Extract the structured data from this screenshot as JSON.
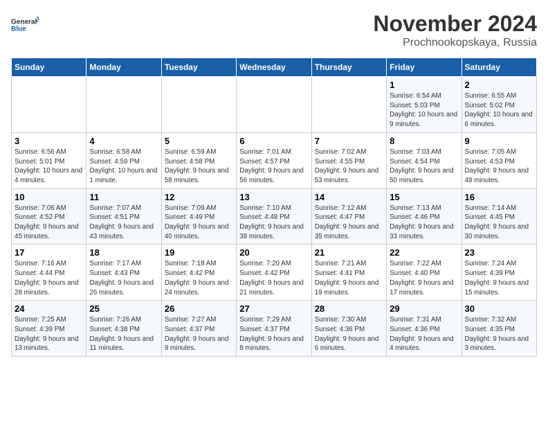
{
  "header": {
    "logo_line1": "General",
    "logo_line2": "Blue",
    "title": "November 2024",
    "location": "Prochnookopskaya, Russia"
  },
  "weekdays": [
    "Sunday",
    "Monday",
    "Tuesday",
    "Wednesday",
    "Thursday",
    "Friday",
    "Saturday"
  ],
  "weeks": [
    [
      {
        "day": "",
        "info": ""
      },
      {
        "day": "",
        "info": ""
      },
      {
        "day": "",
        "info": ""
      },
      {
        "day": "",
        "info": ""
      },
      {
        "day": "",
        "info": ""
      },
      {
        "day": "1",
        "info": "Sunrise: 6:54 AM\nSunset: 5:03 PM\nDaylight: 10 hours and 9 minutes."
      },
      {
        "day": "2",
        "info": "Sunrise: 6:55 AM\nSunset: 5:02 PM\nDaylight: 10 hours and 6 minutes."
      }
    ],
    [
      {
        "day": "3",
        "info": "Sunrise: 6:56 AM\nSunset: 5:01 PM\nDaylight: 10 hours and 4 minutes."
      },
      {
        "day": "4",
        "info": "Sunrise: 6:58 AM\nSunset: 4:59 PM\nDaylight: 10 hours and 1 minute."
      },
      {
        "day": "5",
        "info": "Sunrise: 6:59 AM\nSunset: 4:58 PM\nDaylight: 9 hours and 58 minutes."
      },
      {
        "day": "6",
        "info": "Sunrise: 7:01 AM\nSunset: 4:57 PM\nDaylight: 9 hours and 56 minutes."
      },
      {
        "day": "7",
        "info": "Sunrise: 7:02 AM\nSunset: 4:55 PM\nDaylight: 9 hours and 53 minutes."
      },
      {
        "day": "8",
        "info": "Sunrise: 7:03 AM\nSunset: 4:54 PM\nDaylight: 9 hours and 50 minutes."
      },
      {
        "day": "9",
        "info": "Sunrise: 7:05 AM\nSunset: 4:53 PM\nDaylight: 9 hours and 48 minutes."
      }
    ],
    [
      {
        "day": "10",
        "info": "Sunrise: 7:06 AM\nSunset: 4:52 PM\nDaylight: 9 hours and 45 minutes."
      },
      {
        "day": "11",
        "info": "Sunrise: 7:07 AM\nSunset: 4:51 PM\nDaylight: 9 hours and 43 minutes."
      },
      {
        "day": "12",
        "info": "Sunrise: 7:09 AM\nSunset: 4:49 PM\nDaylight: 9 hours and 40 minutes."
      },
      {
        "day": "13",
        "info": "Sunrise: 7:10 AM\nSunset: 4:48 PM\nDaylight: 9 hours and 38 minutes."
      },
      {
        "day": "14",
        "info": "Sunrise: 7:12 AM\nSunset: 4:47 PM\nDaylight: 9 hours and 35 minutes."
      },
      {
        "day": "15",
        "info": "Sunrise: 7:13 AM\nSunset: 4:46 PM\nDaylight: 9 hours and 33 minutes."
      },
      {
        "day": "16",
        "info": "Sunrise: 7:14 AM\nSunset: 4:45 PM\nDaylight: 9 hours and 30 minutes."
      }
    ],
    [
      {
        "day": "17",
        "info": "Sunrise: 7:16 AM\nSunset: 4:44 PM\nDaylight: 9 hours and 28 minutes."
      },
      {
        "day": "18",
        "info": "Sunrise: 7:17 AM\nSunset: 4:43 PM\nDaylight: 9 hours and 26 minutes."
      },
      {
        "day": "19",
        "info": "Sunrise: 7:18 AM\nSunset: 4:42 PM\nDaylight: 9 hours and 24 minutes."
      },
      {
        "day": "20",
        "info": "Sunrise: 7:20 AM\nSunset: 4:42 PM\nDaylight: 9 hours and 21 minutes."
      },
      {
        "day": "21",
        "info": "Sunrise: 7:21 AM\nSunset: 4:41 PM\nDaylight: 9 hours and 19 minutes."
      },
      {
        "day": "22",
        "info": "Sunrise: 7:22 AM\nSunset: 4:40 PM\nDaylight: 9 hours and 17 minutes."
      },
      {
        "day": "23",
        "info": "Sunrise: 7:24 AM\nSunset: 4:39 PM\nDaylight: 9 hours and 15 minutes."
      }
    ],
    [
      {
        "day": "24",
        "info": "Sunrise: 7:25 AM\nSunset: 4:39 PM\nDaylight: 9 hours and 13 minutes."
      },
      {
        "day": "25",
        "info": "Sunrise: 7:26 AM\nSunset: 4:38 PM\nDaylight: 9 hours and 11 minutes."
      },
      {
        "day": "26",
        "info": "Sunrise: 7:27 AM\nSunset: 4:37 PM\nDaylight: 9 hours and 9 minutes."
      },
      {
        "day": "27",
        "info": "Sunrise: 7:29 AM\nSunset: 4:37 PM\nDaylight: 9 hours and 8 minutes."
      },
      {
        "day": "28",
        "info": "Sunrise: 7:30 AM\nSunset: 4:36 PM\nDaylight: 9 hours and 6 minutes."
      },
      {
        "day": "29",
        "info": "Sunrise: 7:31 AM\nSunset: 4:36 PM\nDaylight: 9 hours and 4 minutes."
      },
      {
        "day": "30",
        "info": "Sunrise: 7:32 AM\nSunset: 4:35 PM\nDaylight: 9 hours and 3 minutes."
      }
    ]
  ]
}
